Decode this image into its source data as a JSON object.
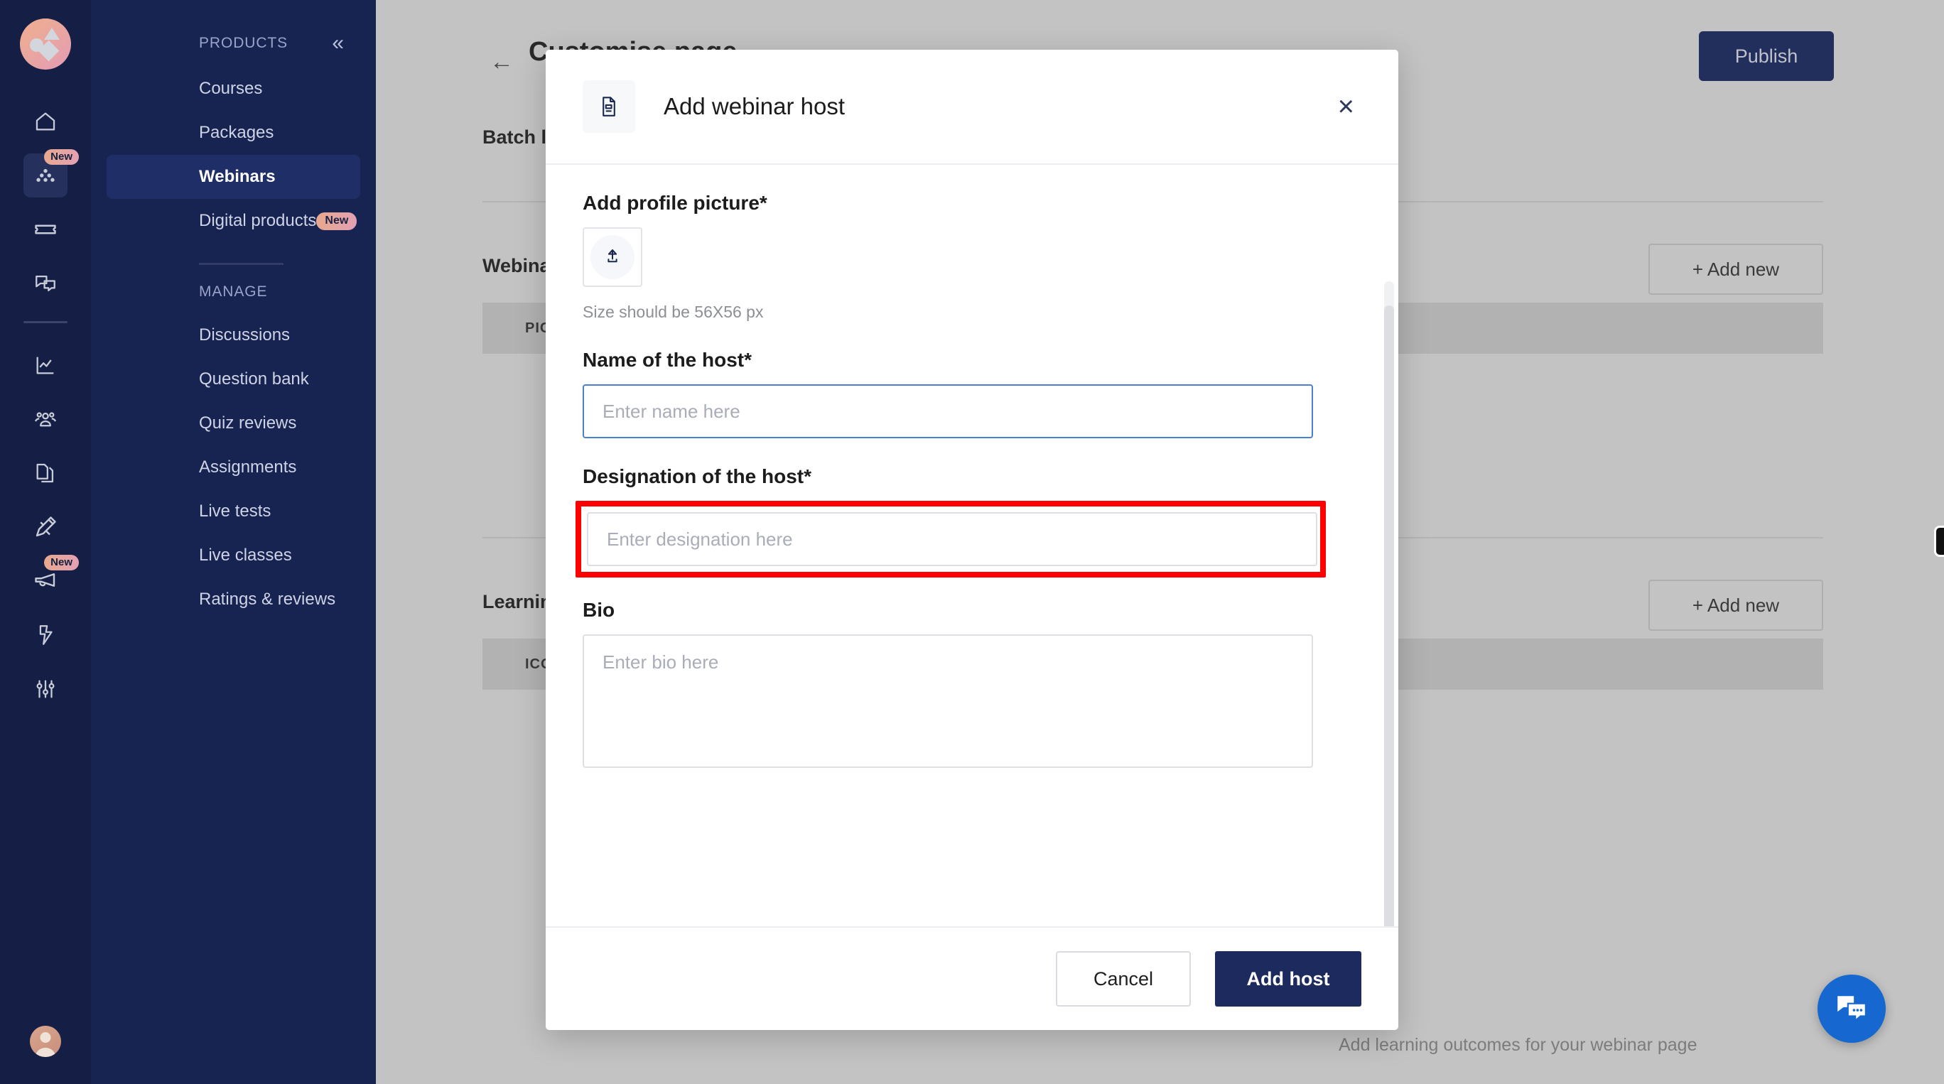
{
  "colors": {
    "rail_bg": "#151f45",
    "subnav_bg": "#172350",
    "active_nav_bg": "#1f2e66",
    "brand_gradient_from": "#efae8e",
    "brand_gradient_to": "#e49cb6",
    "primary_button": "#1d2a5e",
    "focus_border": "#4a7fd1",
    "highlight_box": "#fe0000",
    "chat_fab": "#1668d0",
    "dimmed_page": "#c3c3c3"
  },
  "icon_rail": {
    "logo_name": "brand-logo",
    "items": [
      {
        "icon": "home-icon",
        "badge": ""
      },
      {
        "icon": "products-dots-icon",
        "badge": "New",
        "active": true
      },
      {
        "icon": "ticket-icon",
        "badge": ""
      },
      {
        "icon": "chat-bubbles-icon",
        "badge": ""
      },
      {
        "icon": "analytics-chart-icon",
        "badge": ""
      },
      {
        "icon": "users-group-icon",
        "badge": ""
      },
      {
        "icon": "documents-copy-icon",
        "badge": ""
      },
      {
        "icon": "pencil-ruler-icon",
        "badge": ""
      },
      {
        "icon": "megaphone-icon",
        "badge": "New"
      },
      {
        "icon": "lightning-bolt-icon",
        "badge": ""
      },
      {
        "icon": "sliders-settings-icon",
        "badge": ""
      }
    ],
    "avatar_name": "user-avatar"
  },
  "subnav": {
    "products_title": "PRODUCTS",
    "collapse_label": "«",
    "products_items": [
      {
        "label": "Courses",
        "badge": "",
        "active": false
      },
      {
        "label": "Packages",
        "badge": "",
        "active": false
      },
      {
        "label": "Webinars",
        "badge": "",
        "active": true
      },
      {
        "label": "Digital products",
        "badge": "New",
        "active": false
      }
    ],
    "manage_title": "MANAGE",
    "manage_items": [
      {
        "label": "Discussions"
      },
      {
        "label": "Question bank"
      },
      {
        "label": "Quiz reviews"
      },
      {
        "label": "Assignments"
      },
      {
        "label": "Live tests"
      },
      {
        "label": "Live classes"
      },
      {
        "label": "Ratings & reviews"
      }
    ]
  },
  "background_page": {
    "back_arrow": "←",
    "page_title": "Customise page",
    "publish_label": "Publish",
    "sections": [
      {
        "label": "Batch limit",
        "chip": "",
        "add_new": ""
      },
      {
        "label": "Webinar host",
        "chip": "PICTURE",
        "add_new": "+  Add new"
      },
      {
        "label": "Learning outcomes",
        "chip": "ICON",
        "add_new": "+  Add new"
      }
    ],
    "footer_note": "Add learning outcomes for your webinar page",
    "chat_icon": "chat-support-icon"
  },
  "modal": {
    "header_icon": "document-form-icon",
    "title": "Add webinar host",
    "close_label": "×",
    "profile_picture": {
      "label": "Add profile picture*",
      "upload_icon": "upload-arrow-icon",
      "hint": "Size should be 56X56 px"
    },
    "name_field": {
      "label": "Name of the host*",
      "placeholder": "Enter name here",
      "value": "",
      "focused": true
    },
    "designation_field": {
      "label": "Designation of the host*",
      "placeholder": "Enter designation here",
      "value": "",
      "highlighted": true
    },
    "bio_field": {
      "label": "Bio",
      "placeholder": "Enter bio here",
      "value": ""
    },
    "cancel_label": "Cancel",
    "submit_label": "Add host"
  }
}
